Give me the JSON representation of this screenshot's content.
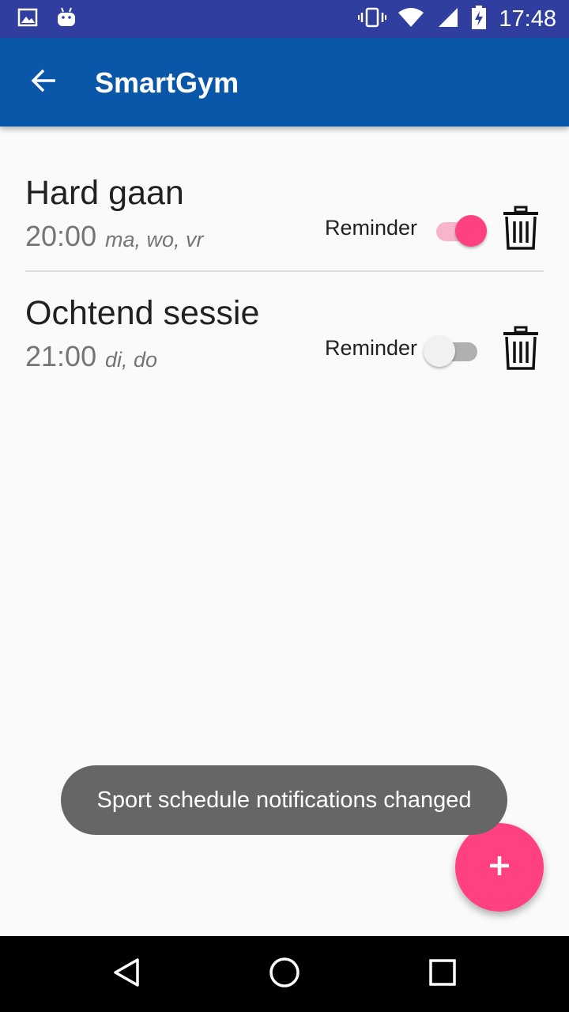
{
  "status_bar": {
    "time": "17:48",
    "icons": [
      "gallery-icon",
      "android-icon",
      "vibrate-icon",
      "wifi-icon",
      "signal-icon",
      "battery-charging-icon"
    ]
  },
  "app_bar": {
    "title": "SmartGym",
    "back_icon": "arrow-back-icon",
    "color": "#0a56a8"
  },
  "schedules": [
    {
      "name": "Hard gaan",
      "time": "20:00",
      "days": "ma, wo, vr",
      "reminder_label": "Reminder",
      "reminder_on": true
    },
    {
      "name": "Ochtend sessie",
      "time": "21:00",
      "days": "di, do",
      "reminder_label": "Reminder",
      "reminder_on": false
    }
  ],
  "toast": {
    "message": "Sport schedule notifications changed"
  },
  "fab": {
    "icon": "plus-icon",
    "color": "#ff4081"
  },
  "nav_bar": {
    "icons": [
      "back-triangle-icon",
      "home-circle-icon",
      "recents-square-icon"
    ]
  }
}
